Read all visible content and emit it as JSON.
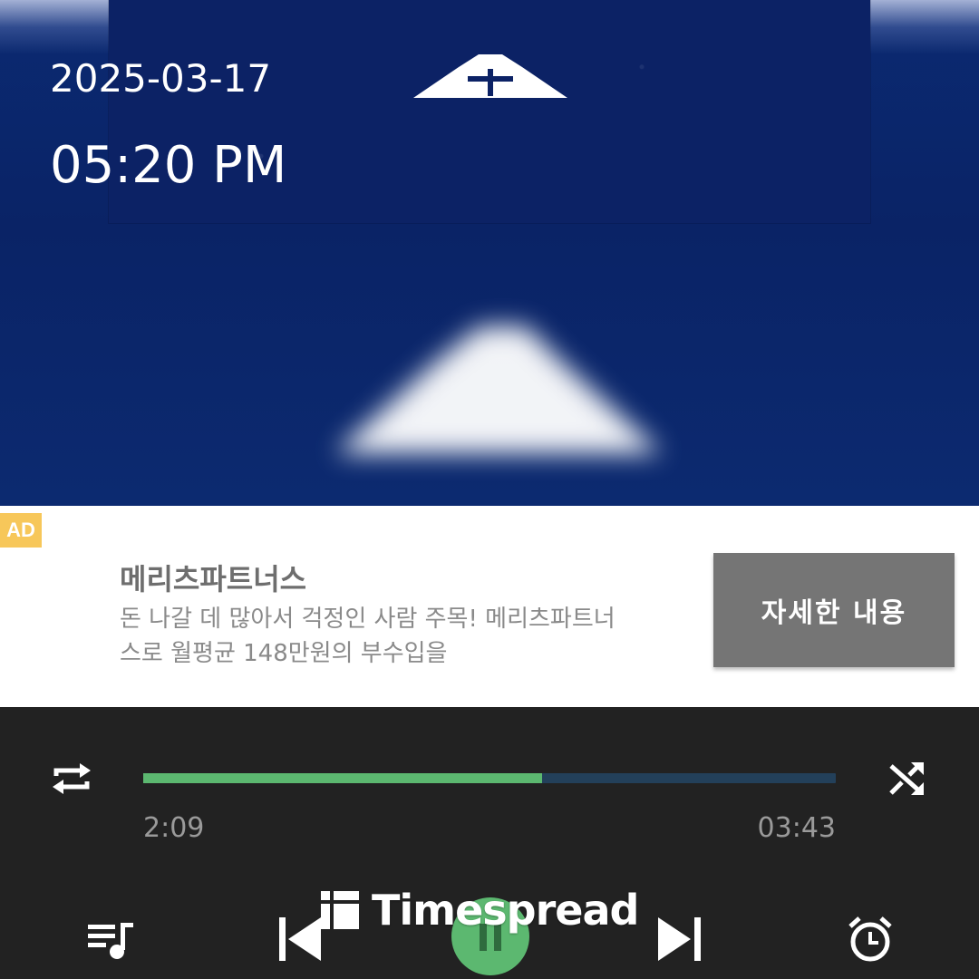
{
  "overlay": {
    "date": "2025-03-17",
    "time": "05:20 PM"
  },
  "album": {
    "logo_icon": "mountain-logo-icon"
  },
  "ad": {
    "badge": "AD",
    "title": "메리츠파트너스",
    "body": "돈 나갈 데 많아서 걱정인 사람 주목! 메리츠파트너스로 월평균 148만원의 부수입을",
    "cta": "자세한 내용",
    "badge_color": "#f7c75a",
    "button_color": "#757575"
  },
  "player": {
    "elapsed": "2:09",
    "total": "03:43",
    "progress": 0.576,
    "accent_color": "#5cb870",
    "track_color": "#23405a",
    "icons": {
      "repeat": "repeat-icon",
      "shuffle": "shuffle-icon",
      "playlist": "playlist-icon",
      "previous": "skip-previous-icon",
      "pause": "pause-icon",
      "next": "skip-next-icon",
      "timer": "alarm-clock-icon"
    }
  },
  "watermark": {
    "text": "Timespread"
  }
}
